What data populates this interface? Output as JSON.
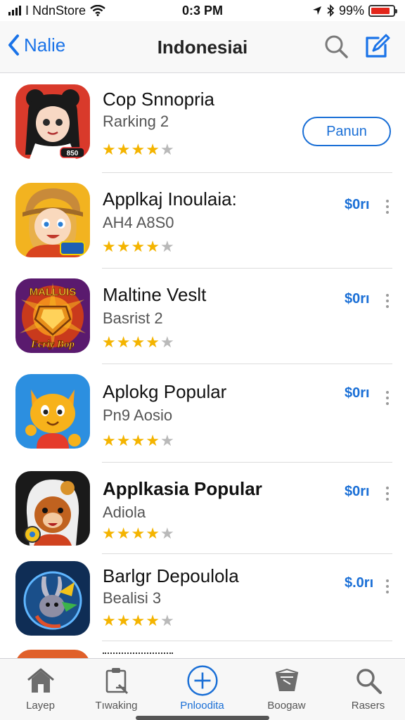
{
  "status_bar": {
    "carrier": "I NdnStore",
    "time": "0:3 PM",
    "battery": "99%"
  },
  "nav": {
    "back_label": "Nalie",
    "title": "Indonesiai"
  },
  "apps": [
    {
      "name": "Cop Snnopria",
      "subtitle": "Rarking 2",
      "rating": 4,
      "action": "Panun",
      "action_style": "outline",
      "icon": "anime-girl-app-icon",
      "icon_badge": "850"
    },
    {
      "name": "Applkaj Inoulaia:",
      "subtitle": "AH4 A8S0",
      "rating": 4,
      "action": "$0rı",
      "action_style": "link",
      "icon": "cartoon-girl-app-icon"
    },
    {
      "name": "Maltine Veslt",
      "subtitle": "Basrist 2",
      "rating": 4,
      "action": "$0rı",
      "action_style": "link",
      "icon": "mallus-game-app-icon",
      "icon_text_top": "MALLUIS",
      "icon_text_bottom": "Ecriy Bop"
    },
    {
      "name": "Aplokg Popular",
      "subtitle": "Pn9 Aosio",
      "rating": 4,
      "action": "$0rı",
      "action_style": "link",
      "icon": "cartoon-cat-app-icon"
    },
    {
      "name": "Applkasia Popular",
      "subtitle": "Adiola",
      "rating": 4,
      "action": "$0rı",
      "action_style": "link",
      "icon": "hooded-bear-app-icon"
    },
    {
      "name": "Barlgr Depoulola",
      "subtitle": "Bealisi 3",
      "rating": 4,
      "action": "$.0rı",
      "action_style": "link",
      "icon": "rabbit-warrior-app-icon"
    }
  ],
  "tabs": [
    {
      "label": "Layeр",
      "icon": "home-icon",
      "active": false
    },
    {
      "label": "Tıwaking",
      "icon": "clipboard-icon",
      "active": false
    },
    {
      "label": "Pnloodita",
      "icon": "plus-circle-icon",
      "active": true
    },
    {
      "label": "Boogaw",
      "icon": "box-icon",
      "active": false
    },
    {
      "label": "Rasers",
      "icon": "search-icon",
      "active": false
    }
  ],
  "colors": {
    "accent": "#1a6fd6",
    "star": "#f4b400",
    "battery_low": "#e3261b"
  }
}
